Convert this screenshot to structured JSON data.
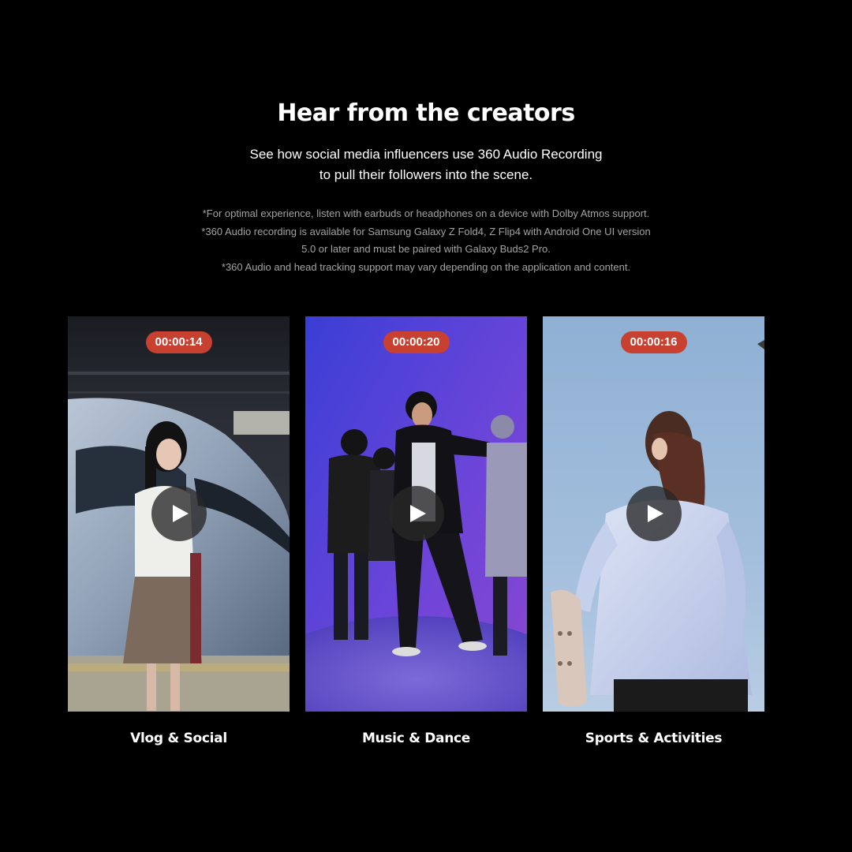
{
  "section": {
    "title": "Hear from the creators",
    "subtitle_lines": [
      "See how social media influencers use 360 Audio Recording",
      "to pull their followers into the scene."
    ],
    "disclaimer_lines": [
      "*For optimal experience, listen with earbuds or headphones on a device with Dolby Atmos support.",
      "*360 Audio recording is available for Samsung Galaxy Z Fold4, Z Flip4 with Android One UI version",
      "5.0 or later and must be paired with Galaxy Buds2 Pro.",
      "*360 Audio and head tracking support may vary depending on the application and content."
    ]
  },
  "videos": [
    {
      "duration": "00:00:14",
      "label": "Vlog & Social",
      "icon": "play-icon"
    },
    {
      "duration": "00:00:20",
      "label": "Music & Dance",
      "icon": "play-icon"
    },
    {
      "duration": "00:00:16",
      "label": "Sports & Activities",
      "icon": "play-icon"
    }
  ],
  "colors": {
    "background": "#000000",
    "duration_badge": "#c8402f",
    "disclaimer_text": "#a3a3a3"
  }
}
